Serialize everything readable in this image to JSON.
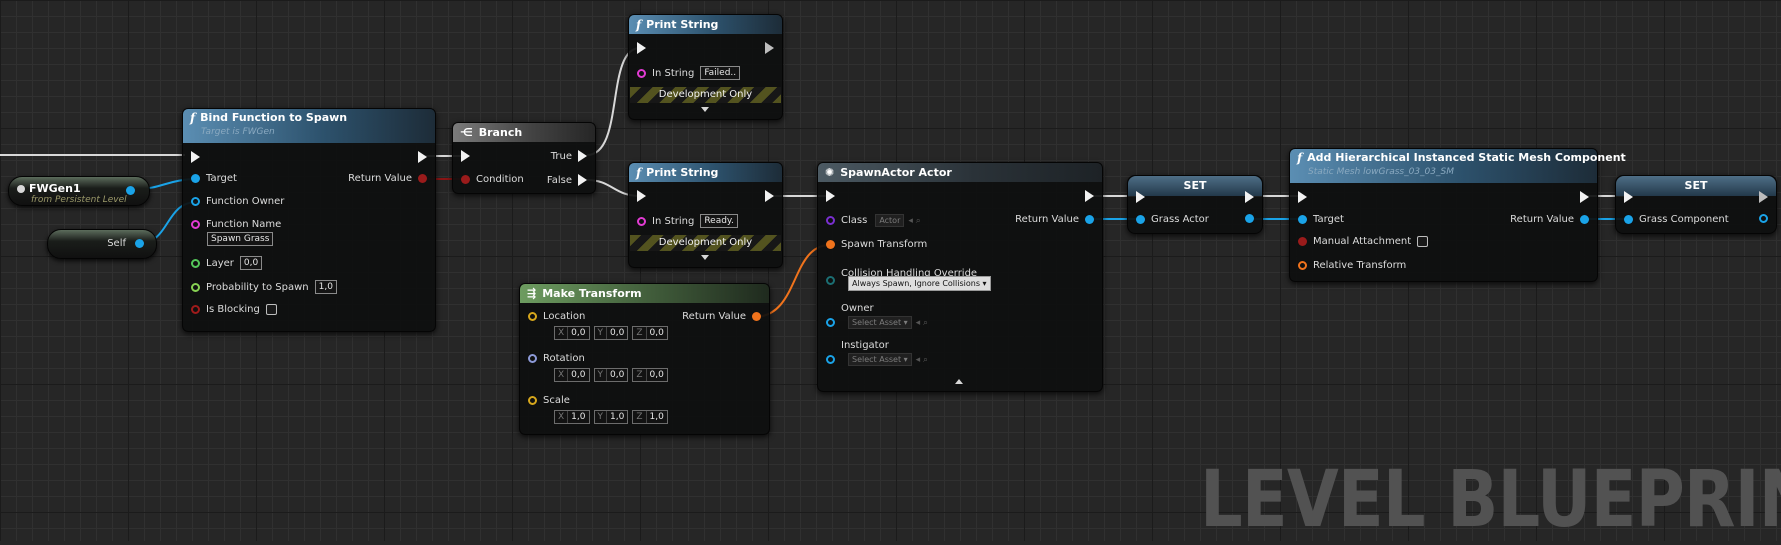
{
  "graph": {
    "watermark": "LEVEL BLUEPRINT"
  },
  "fwgen_node": {
    "title": "FWGen1",
    "subtitle": "from Persistent Level"
  },
  "self_node": {
    "label": "Self"
  },
  "bind_node": {
    "title": "Bind Function to Spawn",
    "subtitle": "Target is FWGen",
    "pins": {
      "target": "Target",
      "function_owner": "Function Owner",
      "function_name": "Function Name",
      "function_name_value": "Spawn Grass",
      "layer": "Layer",
      "layer_value": "0,0",
      "probability": "Probability to Spawn",
      "probability_value": "1,0",
      "is_blocking": "Is Blocking",
      "return_value": "Return Value"
    }
  },
  "branch_node": {
    "title": "Branch",
    "pins": {
      "condition": "Condition",
      "true": "True",
      "false": "False"
    }
  },
  "print_failed": {
    "title": "Print String",
    "in_string": "In String",
    "value": "Failed..",
    "dev_only": "Development Only"
  },
  "print_ready": {
    "title": "Print String",
    "in_string": "In String",
    "value": "Ready.",
    "dev_only": "Development Only"
  },
  "make_transform": {
    "title": "Make Transform",
    "location": "Location",
    "rotation": "Rotation",
    "scale": "Scale",
    "return_value": "Return Value",
    "axes": [
      "X",
      "Y",
      "Z"
    ],
    "location_values": [
      "0,0",
      "0,0",
      "0,0"
    ],
    "rotation_values": [
      "0,0",
      "0,0",
      "0,0"
    ],
    "scale_values": [
      "1,0",
      "1,0",
      "1,0"
    ]
  },
  "spawn_actor": {
    "title": "SpawnActor Actor",
    "class": "Class",
    "class_value": "Actor",
    "return_value": "Return Value",
    "spawn_transform": "Spawn Transform",
    "collision": "Collision Handling Override",
    "collision_value": "Always Spawn, Ignore Collisions",
    "owner": "Owner",
    "owner_value": "Select Asset",
    "instigator": "Instigator",
    "instigator_value": "Select Asset"
  },
  "set_grass_actor": {
    "title": "SET",
    "pin": "Grass Actor"
  },
  "add_hism": {
    "title": "Add Hierarchical Instanced Static Mesh Component",
    "subtitle": "Static Mesh lowGrass_03_03_SM",
    "target": "Target",
    "manual_attachment": "Manual Attachment",
    "relative_transform": "Relative Transform",
    "return_value": "Return Value"
  },
  "set_grass_component": {
    "title": "SET",
    "pin": "Grass Component"
  },
  "icons": {
    "function": "function-icon",
    "branch": "branch-icon",
    "make_transform": "transform-icon",
    "spawn": "spawn-icon",
    "object_ref": "object-icon"
  },
  "colors": {
    "exec": "#f2f2f2",
    "object": "#1aa3e8",
    "bool": "#9a1b1b",
    "string": "#e23bd3",
    "vector": "#d7a71c",
    "rotator": "#8d9ad8",
    "transform": "#f0731c",
    "float": "#87d153",
    "class": "#7a2fd0",
    "byte": "#1b6f73"
  }
}
